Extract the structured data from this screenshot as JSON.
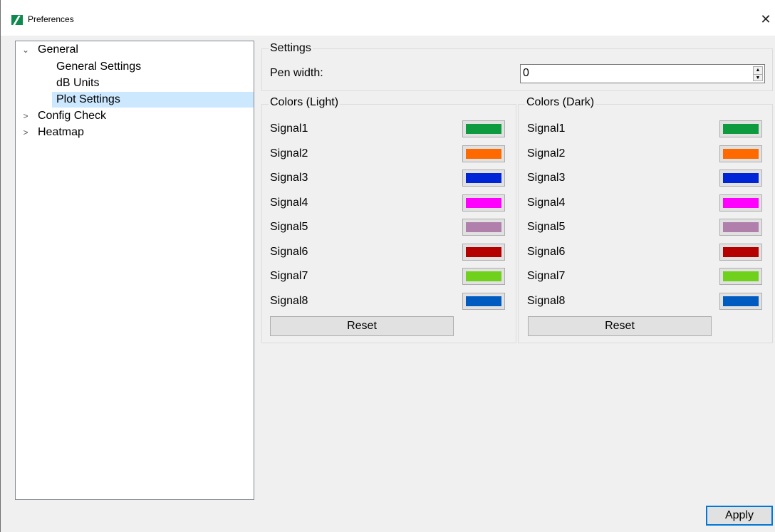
{
  "window": {
    "title": "Preferences",
    "close_glyph": "✕"
  },
  "tree": {
    "items": [
      {
        "label": "General",
        "expanded": true,
        "children": [
          {
            "label": "General Settings"
          },
          {
            "label": "dB Units"
          },
          {
            "label": "Plot Settings",
            "selected": true
          }
        ]
      },
      {
        "label": "Config Check",
        "expanded": false
      },
      {
        "label": "Heatmap",
        "expanded": false
      }
    ],
    "expanded_glyph": "⌄",
    "collapsed_glyph": ">"
  },
  "settings": {
    "title": "Settings",
    "pen_width_label": "Pen width:",
    "pen_width_value": "0"
  },
  "colors_light": {
    "title": "Colors (Light)",
    "signals": [
      {
        "label": "Signal1",
        "color": "#0e9a3e"
      },
      {
        "label": "Signal2",
        "color": "#ff6a00"
      },
      {
        "label": "Signal3",
        "color": "#0025d6"
      },
      {
        "label": "Signal4",
        "color": "#ff00ff"
      },
      {
        "label": "Signal5",
        "color": "#b07fac"
      },
      {
        "label": "Signal6",
        "color": "#b50000"
      },
      {
        "label": "Signal7",
        "color": "#6fd11b"
      },
      {
        "label": "Signal8",
        "color": "#005bc0"
      }
    ],
    "reset_label": "Reset"
  },
  "colors_dark": {
    "title": "Colors (Dark)",
    "signals": [
      {
        "label": "Signal1",
        "color": "#0e9a3e"
      },
      {
        "label": "Signal2",
        "color": "#ff6a00"
      },
      {
        "label": "Signal3",
        "color": "#0025d6"
      },
      {
        "label": "Signal4",
        "color": "#ff00ff"
      },
      {
        "label": "Signal5",
        "color": "#b07fac"
      },
      {
        "label": "Signal6",
        "color": "#b50000"
      },
      {
        "label": "Signal7",
        "color": "#6fd11b"
      },
      {
        "label": "Signal8",
        "color": "#005bc0"
      }
    ],
    "reset_label": "Reset"
  },
  "footer": {
    "apply_label": "Apply"
  },
  "colors": {
    "selection": "#cce8ff",
    "accent": "#0078d7"
  }
}
